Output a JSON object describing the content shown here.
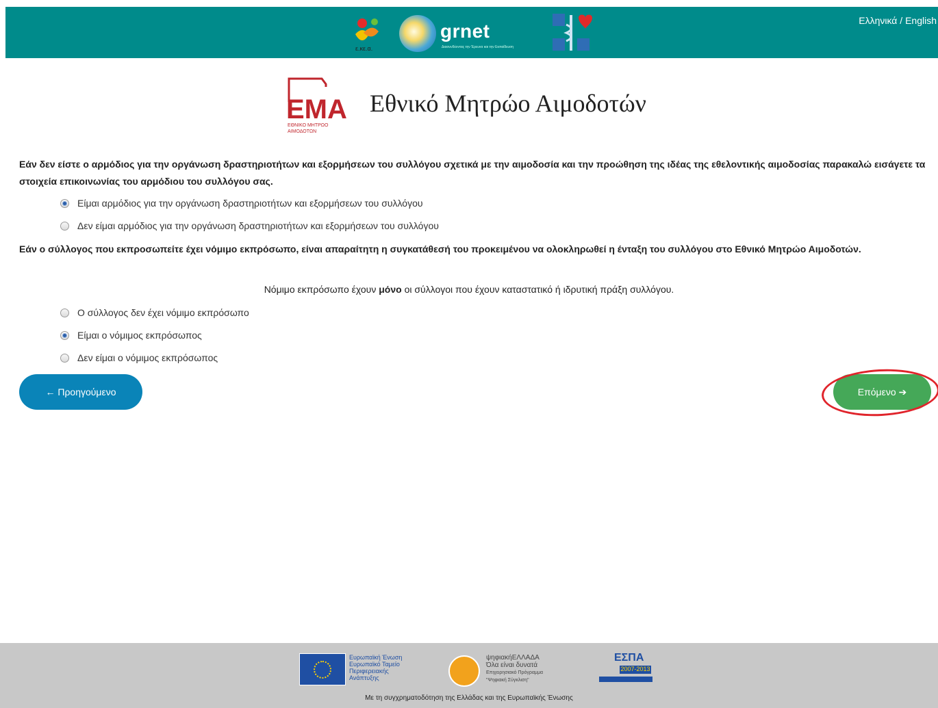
{
  "header": {
    "lang_el": "Ελληνικά",
    "lang_sep": " / ",
    "lang_en": "English",
    "logos": {
      "ekea_label": "ε.κε.α.",
      "grnet_word": "grnet",
      "grnet_tagline": "Διασυνδέοντας την Έρευνα και την Εκπαίδευση"
    }
  },
  "title": {
    "logo_text": "ΕΜΑ",
    "logo_sub1": "ΕΘΝΙΚΟ ΜΗΤΡΩΟ",
    "logo_sub2": "ΑΙΜΟΔΟΤΩΝ",
    "text": "Εθνικό Μητρώο Αιμοδοτών"
  },
  "section1": {
    "question": "Εάν δεν είστε ο αρμόδιος για την οργάνωση δραστηριοτήτων και εξορμήσεων του συλλόγου σχετικά με την αιμοδοσία και την προώθηση της ιδέας της εθελοντικής αιμοδοσίας παρακαλώ εισάγετε τα στοιχεία επικοινωνίας του αρμόδιου του συλλόγου σας.",
    "options": [
      {
        "label": "Είμαι αρμόδιος για την οργάνωση δραστηριοτήτων και εξορμήσεων του συλλόγου",
        "checked": true
      },
      {
        "label": "Δεν είμαι αρμόδιος για την οργάνωση δραστηριοτήτων και εξορμήσεων του συλλόγου",
        "checked": false
      }
    ]
  },
  "section2": {
    "question": "Εάν ο σύλλογος που εκπροσωπείτε έχει νόμιμο εκπρόσωπο, είναι απαραίτητη η συγκατάθεσή του προκειμένου να ολοκληρωθεί η ένταξη του συλλόγου στο Εθνικό Μητρώο Αιμοδοτών.",
    "note_before": "Νόμιμο εκπρόσωπο έχουν ",
    "note_bold": "μόνο",
    "note_after": " οι σύλλογοι που έχουν καταστατικό ή ιδρυτική πράξη συλλόγου.",
    "options": [
      {
        "label": "Ο σύλλογος δεν έχει νόμιμο εκπρόσωπο",
        "checked": false
      },
      {
        "label": "Είμαι ο νόμιμος εκπρόσωπος",
        "checked": true
      },
      {
        "label": "Δεν είμαι ο νόμιμος εκπρόσωπος",
        "checked": false
      }
    ]
  },
  "buttons": {
    "prev": "← Προηγούμενο",
    "next": "Επόμενο ➔"
  },
  "footer": {
    "eu_line1": "Ευρωπαϊκή Ένωση",
    "eu_line2": "Ευρωπαϊκό Ταμείο",
    "eu_line3": "Περιφερειακής",
    "eu_line4": "Ανάπτυξης",
    "digital_line1": "ψηφιακήΕΛΛΑΔΑ",
    "digital_line2": "Όλα είναι δυνατά",
    "digital_line3": "Επιχειρησιακό Πρόγραμμα",
    "digital_line4": "\"Ψηφιακή Σύγκλιση\"",
    "espa_title": "ΕΣΠΑ",
    "espa_years": "2007-2013",
    "funding": "Με τη συγχρηματοδότηση της Ελλάδας και της Ευρωπαϊκής Ένωσης"
  },
  "colors": {
    "header_bg": "#008b8b",
    "prev_button": "#0a84b8",
    "next_button": "#45a858",
    "highlight_ring": "#e0242b",
    "footer_bg": "#c8c8c8"
  }
}
